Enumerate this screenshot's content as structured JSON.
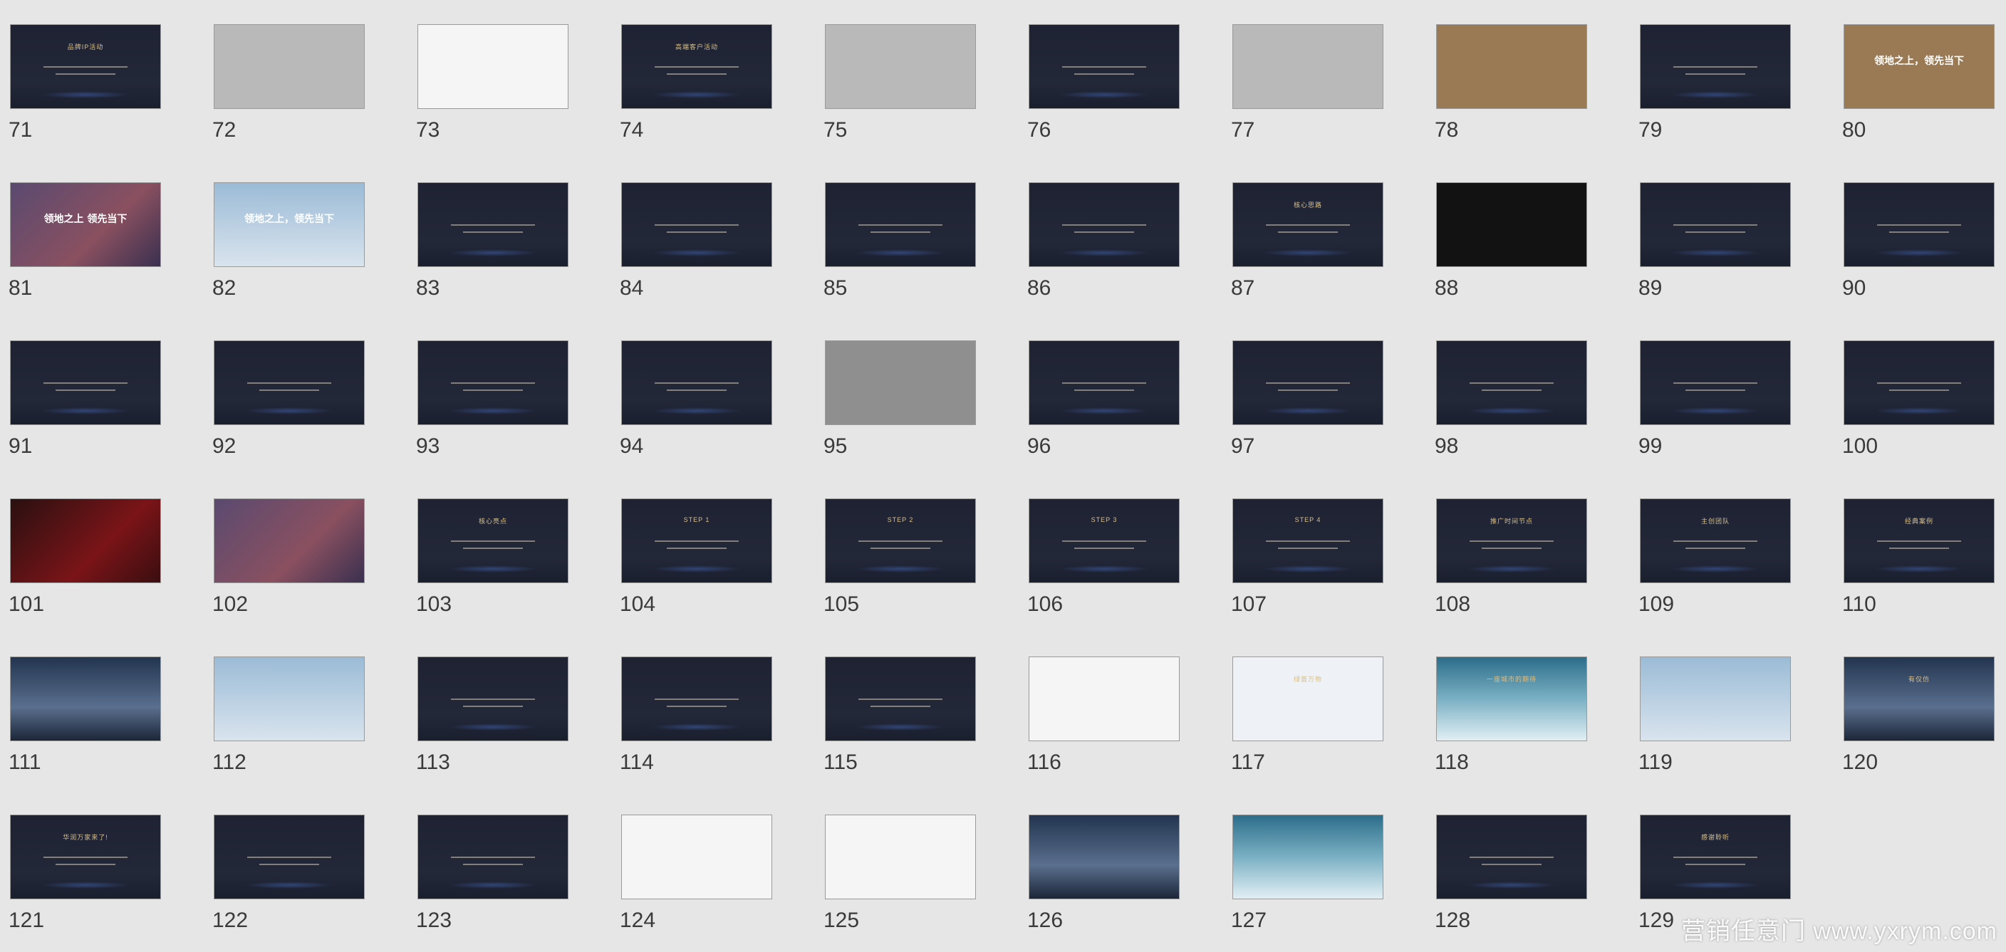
{
  "slides": [
    {
      "number": "71",
      "style": "t-dark",
      "title": "品牌IP活动"
    },
    {
      "number": "72",
      "style": "t-gray",
      "title": ""
    },
    {
      "number": "73",
      "style": "t-white",
      "title": ""
    },
    {
      "number": "74",
      "style": "t-dark",
      "title": "高端客户活动"
    },
    {
      "number": "75",
      "style": "t-gray",
      "title": ""
    },
    {
      "number": "76",
      "style": "t-dark",
      "title": ""
    },
    {
      "number": "77",
      "style": "t-gray",
      "title": ""
    },
    {
      "number": "78",
      "style": "t-gold",
      "title": ""
    },
    {
      "number": "79",
      "style": "t-dark",
      "title": ""
    },
    {
      "number": "80",
      "style": "t-gold",
      "title": "领地之上，领先当下"
    },
    {
      "number": "81",
      "style": "t-purple",
      "title": "领地之上 领先当下"
    },
    {
      "number": "82",
      "style": "t-sky",
      "title": "领地之上，领先当下"
    },
    {
      "number": "83",
      "style": "t-dark",
      "title": ""
    },
    {
      "number": "84",
      "style": "t-dark",
      "title": ""
    },
    {
      "number": "85",
      "style": "t-dark",
      "title": ""
    },
    {
      "number": "86",
      "style": "t-dark",
      "title": ""
    },
    {
      "number": "87",
      "style": "t-dark",
      "title": "核心思路"
    },
    {
      "number": "88",
      "style": "t-black",
      "title": ""
    },
    {
      "number": "89",
      "style": "t-dark",
      "title": ""
    },
    {
      "number": "90",
      "style": "t-dark",
      "title": ""
    },
    {
      "number": "91",
      "style": "t-dark",
      "title": ""
    },
    {
      "number": "92",
      "style": "t-dark",
      "title": ""
    },
    {
      "number": "93",
      "style": "t-dark",
      "title": ""
    },
    {
      "number": "94",
      "style": "t-dark",
      "title": ""
    },
    {
      "number": "95",
      "style": "t-lightgray",
      "title": ""
    },
    {
      "number": "96",
      "style": "t-dark",
      "title": ""
    },
    {
      "number": "97",
      "style": "t-dark",
      "title": ""
    },
    {
      "number": "98",
      "style": "t-dark",
      "title": ""
    },
    {
      "number": "99",
      "style": "t-dark",
      "title": ""
    },
    {
      "number": "100",
      "style": "t-dark",
      "title": ""
    },
    {
      "number": "101",
      "style": "t-red",
      "title": ""
    },
    {
      "number": "102",
      "style": "t-purple",
      "title": ""
    },
    {
      "number": "103",
      "style": "t-dark",
      "title": "核心亮点"
    },
    {
      "number": "104",
      "style": "t-dark",
      "title": "STEP 1"
    },
    {
      "number": "105",
      "style": "t-dark",
      "title": "STEP 2"
    },
    {
      "number": "106",
      "style": "t-dark",
      "title": "STEP 3"
    },
    {
      "number": "107",
      "style": "t-dark",
      "title": "STEP 4"
    },
    {
      "number": "108",
      "style": "t-dark",
      "title": "推广时间节点"
    },
    {
      "number": "109",
      "style": "t-dark",
      "title": "主创团队"
    },
    {
      "number": "110",
      "style": "t-dark",
      "title": "经典案例"
    },
    {
      "number": "111",
      "style": "t-city",
      "title": ""
    },
    {
      "number": "112",
      "style": "t-sky",
      "title": ""
    },
    {
      "number": "113",
      "style": "t-dark",
      "title": ""
    },
    {
      "number": "114",
      "style": "t-dark",
      "title": ""
    },
    {
      "number": "115",
      "style": "t-dark",
      "title": ""
    },
    {
      "number": "116",
      "style": "t-white",
      "title": ""
    },
    {
      "number": "117",
      "style": "t-banner",
      "title": "绿荟万物"
    },
    {
      "number": "118",
      "style": "t-sea",
      "title": "一座城市的期待"
    },
    {
      "number": "119",
      "style": "t-sky",
      "title": ""
    },
    {
      "number": "120",
      "style": "t-city",
      "title": "有仅仿"
    },
    {
      "number": "121",
      "style": "t-dark",
      "title": "华润万家来了!"
    },
    {
      "number": "122",
      "style": "t-dark",
      "title": ""
    },
    {
      "number": "123",
      "style": "t-dark",
      "title": ""
    },
    {
      "number": "124",
      "style": "t-white",
      "title": ""
    },
    {
      "number": "125",
      "style": "t-white",
      "title": ""
    },
    {
      "number": "126",
      "style": "t-city",
      "title": ""
    },
    {
      "number": "127",
      "style": "t-sea",
      "title": ""
    },
    {
      "number": "128",
      "style": "t-dark",
      "title": ""
    },
    {
      "number": "129",
      "style": "t-dark",
      "title": "感谢聆听"
    }
  ],
  "watermark": "营销任意门 www.yxrym.com"
}
